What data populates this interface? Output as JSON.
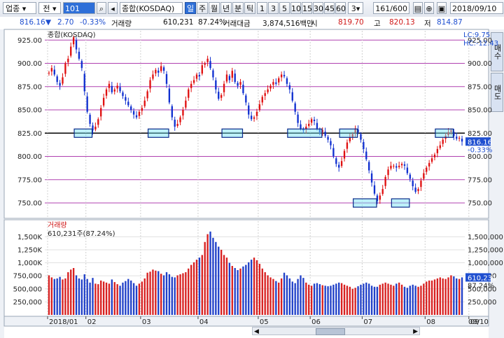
{
  "toolbar": {
    "market": "업종",
    "type_sel": "전",
    "code": "101",
    "name": "종합(KOSDAQ)",
    "periods": [
      "일",
      "주",
      "월",
      "년",
      "분",
      "틱"
    ],
    "active_period": "일",
    "intervals": [
      "1",
      "3",
      "5",
      "10",
      "15",
      "30",
      "45",
      "60"
    ],
    "interval_select": "3",
    "count": "161",
    "count_total": "/600",
    "date": "2018/09/10"
  },
  "infobar": {
    "price": "816.16",
    "change": "2.70",
    "change_pct": "-0.33%",
    "volume_label": "거래량",
    "volume": "610,231",
    "volume_pct": "87.24%",
    "amount_label": "거래대금",
    "amount": "3,874,516백만",
    "open_label": "시",
    "open": "819.70",
    "high_label": "고",
    "high": "820.13",
    "low_label": "저",
    "low": "814.87"
  },
  "side_left": {
    "buy_button": "매수",
    "sell_button": "매도"
  },
  "chart_data": [
    {
      "type": "candlestick",
      "title": "종합(KOSDAQ)",
      "ylim": [
        735,
        935
      ],
      "y_ticks": [
        "925.00",
        "900.00",
        "875.00",
        "850.00",
        "825.00",
        "800.00",
        "775.00",
        "750.00"
      ],
      "y_tick_values": [
        925,
        900,
        875,
        850,
        825,
        800,
        775,
        750
      ],
      "x_ticks": [
        "2018/01",
        "02",
        "03",
        "04",
        "05",
        "06",
        "07",
        "08",
        "09"
      ],
      "x_tick_index": [
        0,
        14,
        34,
        55,
        77,
        96,
        115,
        138,
        154
      ],
      "last_label": "816.16",
      "last_pct": "-0.33%",
      "lc": "LC:9.75",
      "hc": "HC:-12.43",
      "support_line": 825,
      "grid": true,
      "closes": [
        890,
        895,
        888,
        880,
        876,
        885,
        900,
        905,
        918,
        928,
        915,
        905,
        895,
        870,
        848,
        835,
        828,
        832,
        840,
        852,
        863,
        872,
        878,
        869,
        872,
        876,
        870,
        865,
        860,
        855,
        850,
        845,
        842,
        848,
        852,
        860,
        870,
        882,
        888,
        893,
        890,
        897,
        892,
        878,
        858,
        842,
        832,
        835,
        842,
        850,
        860,
        872,
        878,
        882,
        888,
        886,
        898,
        900,
        905,
        895,
        885,
        872,
        862,
        866,
        878,
        888,
        882,
        892,
        880,
        876,
        880,
        868,
        858,
        845,
        840,
        842,
        848,
        856,
        864,
        868,
        872,
        876,
        880,
        878,
        884,
        888,
        886,
        878,
        872,
        860,
        848,
        836,
        830,
        828,
        832,
        835,
        840,
        838,
        830,
        826,
        828,
        822,
        818,
        812,
        800,
        792,
        788,
        795,
        806,
        815,
        820,
        824,
        830,
        826,
        818,
        808,
        797,
        785,
        772,
        760,
        752,
        758,
        765,
        778,
        786,
        790,
        790,
        788,
        790,
        792,
        790,
        782,
        776,
        768,
        762,
        765,
        774,
        782,
        788,
        793,
        798,
        802,
        808,
        812,
        818,
        822,
        826,
        828,
        822,
        819,
        820,
        816
      ],
      "volumes": [
        760,
        720,
        690,
        700,
        730,
        680,
        700,
        820,
        870,
        900,
        760,
        700,
        680,
        780,
        690,
        620,
        710,
        600,
        590,
        660,
        640,
        620,
        600,
        680,
        630,
        590,
        560,
        620,
        650,
        690,
        660,
        610,
        560,
        600,
        640,
        700,
        810,
        830,
        870,
        850,
        840,
        790,
        760,
        820,
        780,
        730,
        720,
        760,
        780,
        800,
        820,
        890,
        960,
        1010,
        1060,
        1100,
        1150,
        1400,
        1550,
        1600,
        1480,
        1400,
        1310,
        1250,
        1150,
        1100,
        1000,
        940,
        900,
        860,
        890,
        930,
        960,
        1010,
        1060,
        1100,
        1050,
        980,
        890,
        820,
        760,
        720,
        690,
        650,
        620,
        700,
        810,
        760,
        700,
        640,
        610,
        690,
        760,
        710,
        620,
        580,
        560,
        600,
        610,
        590,
        570,
        560,
        550,
        560,
        580,
        600,
        620,
        610,
        580,
        560,
        540,
        500,
        520,
        550,
        580,
        600,
        620,
        600,
        560,
        540,
        540,
        580,
        600,
        620,
        600,
        580,
        560,
        600,
        620,
        580,
        540,
        520,
        560,
        580,
        560,
        540,
        560,
        600,
        640,
        660,
        660,
        680,
        700,
        720,
        700,
        690,
        720,
        760,
        740,
        700,
        690,
        720,
        610
      ],
      "volume_panel": {
        "title": "거래량",
        "last": "610,231주(87.24%)",
        "y_ticks": [
          "1,500,000",
          "1,250,000",
          "1,000,000",
          "750,000",
          "500,000",
          "250,000"
        ],
        "y_ticks_left": [
          "1,500K",
          "1,250K",
          "1,000K",
          "750,000",
          "500,000",
          "250,000"
        ],
        "y_tick_values": [
          1500,
          1250,
          1000,
          750,
          500,
          250
        ],
        "last_label": "610,231",
        "last_pct": "87.24%"
      },
      "bottom_date": "09/10"
    }
  ]
}
